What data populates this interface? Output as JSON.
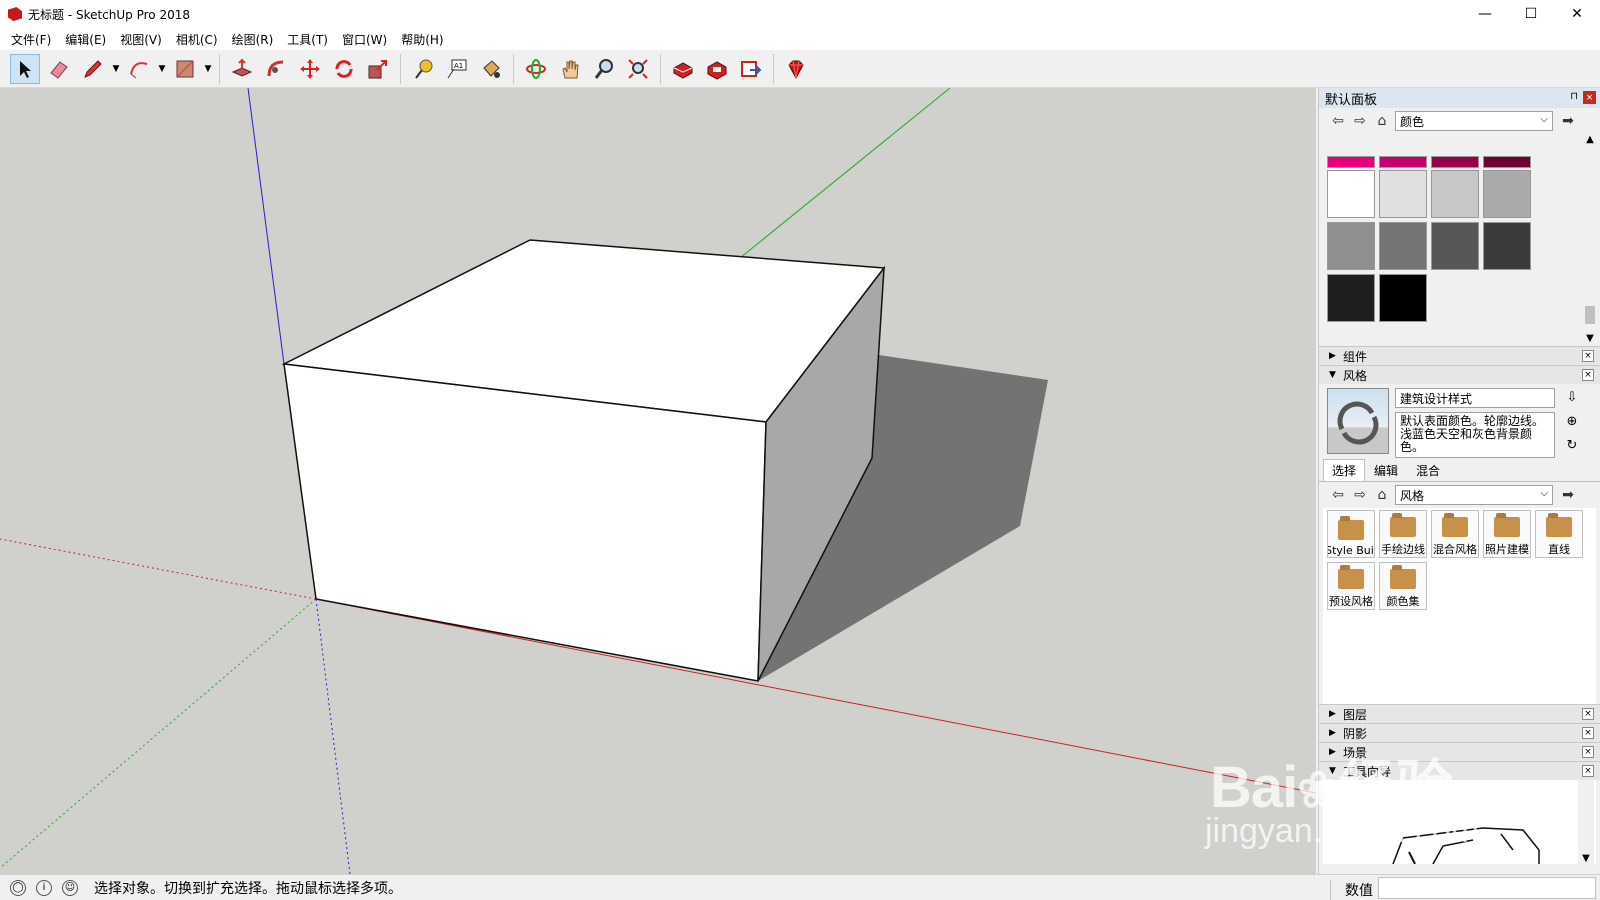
{
  "window": {
    "title": "无标题 - SketchUp Pro 2018",
    "minimize": "—",
    "maximize": "☐",
    "close": "✕"
  },
  "menu": [
    "文件(F)",
    "编辑(E)",
    "视图(V)",
    "相机(C)",
    "绘图(R)",
    "工具(T)",
    "窗口(W)",
    "帮助(H)"
  ],
  "toolbar": {
    "icons": [
      "select-icon",
      "eraser-icon",
      "pencil-icon",
      "arc-icon",
      "rectangle-icon",
      "push-pull-icon",
      "follow-me-icon",
      "move-icon",
      "rotate-icon",
      "scale-icon",
      "tape-measure-icon",
      "text-icon",
      "paint-bucket-icon",
      "orbit-icon",
      "pan-icon",
      "zoom-icon",
      "zoom-extents-icon",
      "warehouse-icon",
      "extension-warehouse-icon",
      "send-to-layout-icon",
      "ruby-icon"
    ]
  },
  "tray": {
    "title": "默认面板",
    "pin": "⊓",
    "close": "×",
    "materials": {
      "dropdown": "颜色",
      "colors": {
        "row0": [
          "#e6007e",
          "#c3006b",
          "#960049",
          "#6b0033"
        ],
        "row1": [
          "#ffffff",
          "#e0e0e0",
          "#c7c7c7",
          "#aaaaaa"
        ],
        "row2": [
          "#8f8f8f",
          "#747474",
          "#575757",
          "#3b3b3b"
        ],
        "row3": [
          "#1e1e1e",
          "#000000"
        ]
      }
    },
    "sections": {
      "components": "组件",
      "styles": "风格",
      "layers": "图层",
      "shadows": "阴影",
      "scenes": "场景",
      "instructor": "工具向导"
    },
    "style": {
      "name": "建筑设计样式",
      "description": "默认表面颜色。轮廓边线。浅蓝色天空和灰色背景颜色。",
      "tabs": [
        "选择",
        "编辑",
        "混合"
      ],
      "dropdown": "风格",
      "tiles": [
        "Style Buil",
        "手绘边线",
        "混合风格",
        "照片建模",
        "直线",
        "预设风格",
        "颜色集"
      ]
    }
  },
  "status": {
    "message": "选择对象。切换到扩充选择。拖动鼠标选择多项。",
    "value_label": "数值",
    "value": ""
  },
  "watermark": {
    "line1": "Bai",
    "line1b": "经验",
    "line2": "jingyan.baidu.com"
  }
}
